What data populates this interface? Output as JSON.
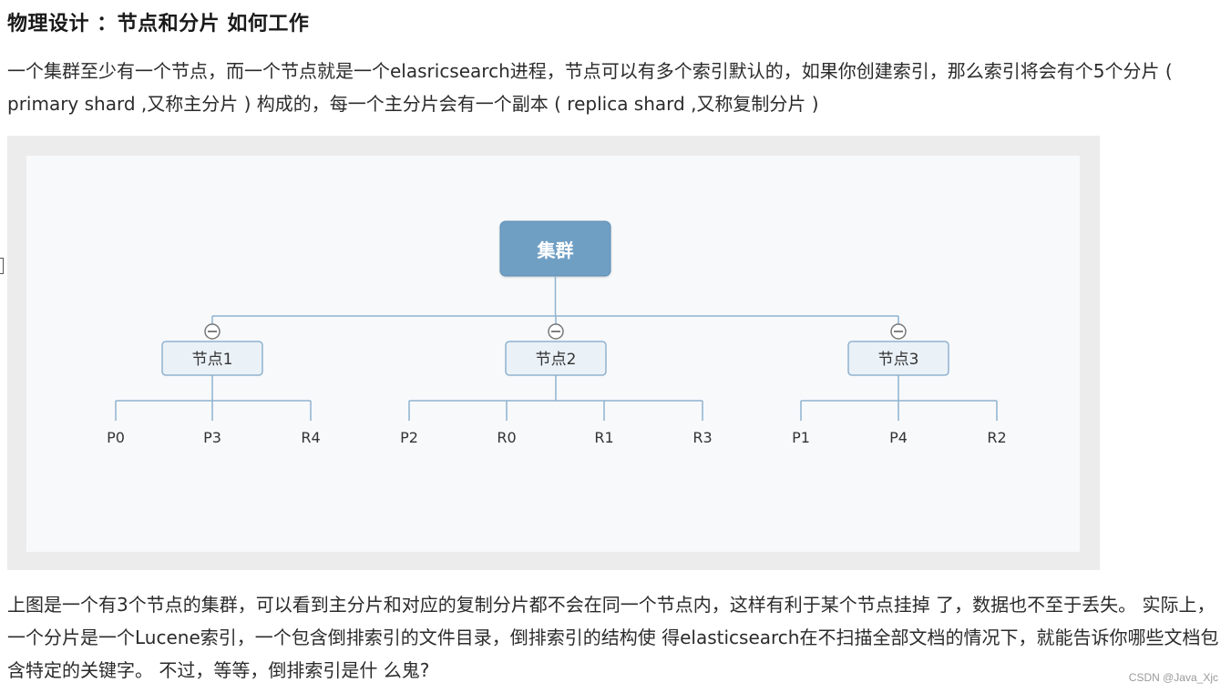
{
  "heading": "物理设计 ：节点和分片 如何工作",
  "intro_paragraph": "一个集群至少有一个节点，而一个节点就是一个elasricsearch进程，节点可以有多个索引默认的，如果你创建索引，那么索引将会有个5个分片 ( primary shard ,又称主分片 ) 构成的，每一个主分片会有一个副本 ( replica shard ,又称复制分片 )",
  "diagram": {
    "root": "集群",
    "nodes": [
      {
        "label": "节点1",
        "shards": [
          "P0",
          "P3",
          "R4"
        ]
      },
      {
        "label": "节点2",
        "shards": [
          "P2",
          "R0",
          "R1",
          "R3"
        ]
      },
      {
        "label": "节点3",
        "shards": [
          "P1",
          "P4",
          "R2"
        ]
      }
    ],
    "colors": {
      "root_fill": "#6f9fc4",
      "node_fill": "#eaf1f7",
      "line": "#8fb3cf"
    }
  },
  "explanation_paragraph": "上图是一个有3个节点的集群，可以看到主分片和对应的复制分片都不会在同一个节点内，这样有利于某个节点挂掉 了，数据也不至于丢失。 实际上，一个分片是一个Lucene索引，一个包含倒排索引的文件目录，倒排索引的结构使 得elasticsearch在不扫描全部文档的情况下，就能告诉你哪些文档包含特定的关键字。 不过，等等，倒排索引是什 么鬼?",
  "watermark": "CSDN @Java_Xjc"
}
